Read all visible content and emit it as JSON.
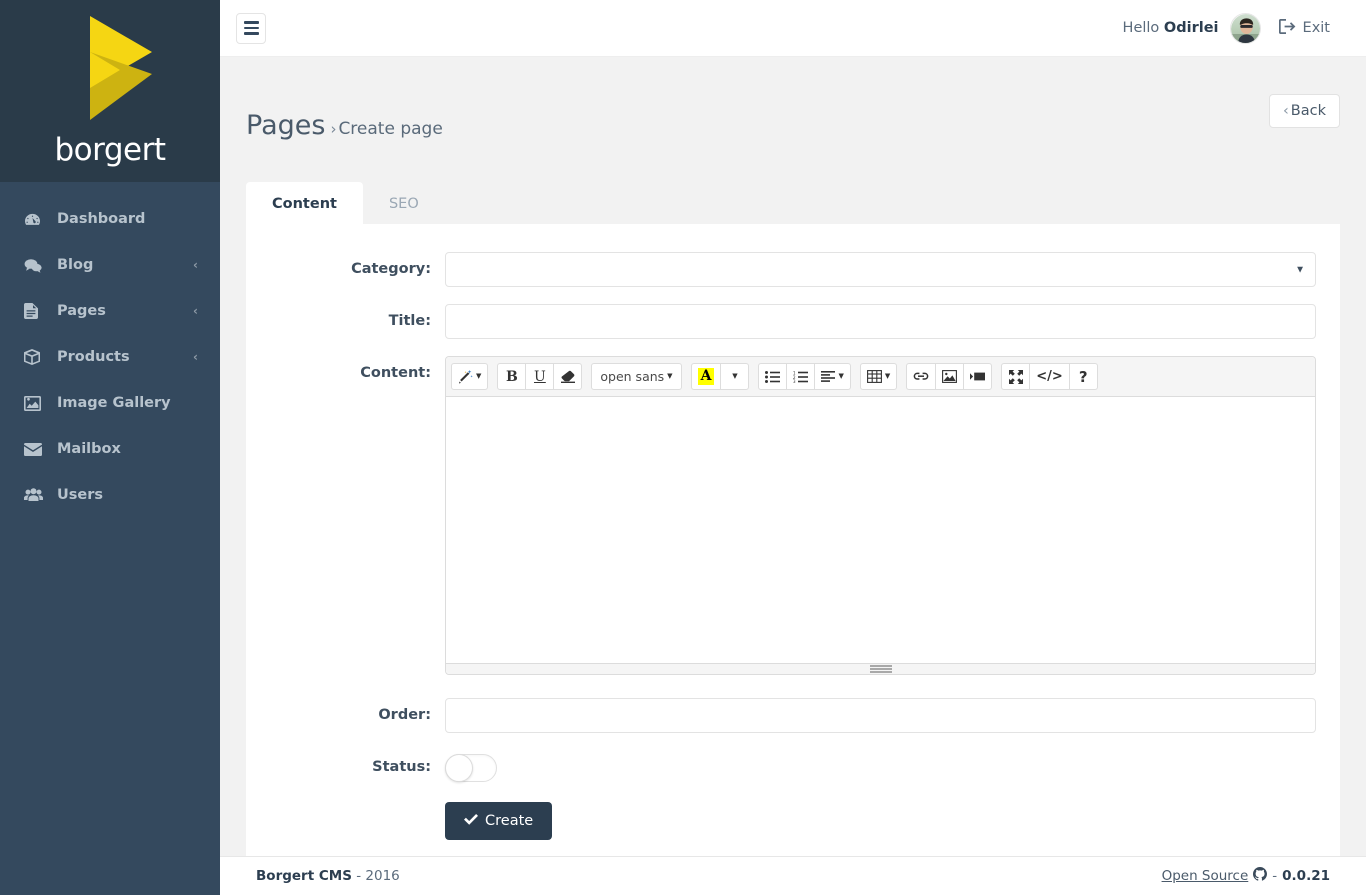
{
  "brand": {
    "logo_word": "borgert",
    "logo_icon": "play-triangle-logo",
    "colors": {
      "logo_light": "#f5d613",
      "logo_dark": "#cdb311",
      "sidebar": "#34495e",
      "sidebar_dark": "#2a3b49",
      "accent": "#2c3e50",
      "highlight": "#ffff00"
    }
  },
  "sidebar": {
    "items": [
      {
        "label": "Dashboard",
        "icon": "tachometer-icon",
        "caret": ""
      },
      {
        "label": "Blog",
        "icon": "comments-icon",
        "caret": "‹"
      },
      {
        "label": "Pages",
        "icon": "file-text-icon",
        "caret": "‹"
      },
      {
        "label": "Products",
        "icon": "cube-icon",
        "caret": "‹"
      },
      {
        "label": "Image Gallery",
        "icon": "image-icon",
        "caret": ""
      },
      {
        "label": "Mailbox",
        "icon": "envelope-icon",
        "caret": ""
      },
      {
        "label": "Users",
        "icon": "users-icon",
        "caret": ""
      }
    ]
  },
  "topbar": {
    "menu_icon": "hamburger-icon",
    "greeting": "Hello",
    "username": "Odirlei",
    "avatar_icon": "user-avatar-photo",
    "exit_icon": "sign-out-icon",
    "exit_label": "Exit"
  },
  "page": {
    "title": "Pages",
    "separator": "›",
    "breadcrumb": "Create page",
    "back_label": "Back",
    "back_chevron": "‹"
  },
  "tabs": [
    {
      "label": "Content",
      "active": true
    },
    {
      "label": "SEO",
      "active": false
    }
  ],
  "form": {
    "category": {
      "label": "Category:",
      "value": "",
      "placeholder": "",
      "options": [
        ""
      ]
    },
    "title": {
      "label": "Title:",
      "value": "",
      "placeholder": ""
    },
    "content": {
      "label": "Content:",
      "value": "",
      "placeholder": ""
    },
    "order": {
      "label": "Order:",
      "value": "",
      "placeholder": ""
    },
    "status": {
      "label": "Status:",
      "value": "off"
    },
    "submit": {
      "label": "Create",
      "icon": "check-icon"
    }
  },
  "editor": {
    "font_name": "open sans",
    "recent_color_letter": "A",
    "toolbar": [
      {
        "name": "style-magic-wand",
        "icon": "magic-icon",
        "caret": true
      },
      {
        "name": "bold",
        "icon": "bold-icon",
        "caret": false
      },
      {
        "name": "underline",
        "icon": "underline-icon",
        "caret": false
      },
      {
        "name": "clear-formatting",
        "icon": "eraser-icon",
        "caret": false
      },
      {
        "name": "font-name",
        "icon": "font-name-dropdown",
        "caret": true
      },
      {
        "name": "recent-color",
        "icon": "highlight-a-icon",
        "caret": false
      },
      {
        "name": "color-dropdown",
        "icon": "caret-down-icon",
        "caret": true
      },
      {
        "name": "unordered-list",
        "icon": "list-ul-icon",
        "caret": false
      },
      {
        "name": "ordered-list",
        "icon": "list-ol-icon",
        "caret": false
      },
      {
        "name": "paragraph-align",
        "icon": "align-left-icon",
        "caret": true
      },
      {
        "name": "table",
        "icon": "table-icon",
        "caret": true
      },
      {
        "name": "link",
        "icon": "link-icon",
        "caret": false
      },
      {
        "name": "picture",
        "icon": "picture-icon",
        "caret": false
      },
      {
        "name": "video",
        "icon": "video-icon",
        "caret": false
      },
      {
        "name": "fullscreen",
        "icon": "arrows-alt-icon",
        "caret": false
      },
      {
        "name": "code-view",
        "icon": "code-icon",
        "caret": false
      },
      {
        "name": "help",
        "icon": "question-icon",
        "caret": false
      }
    ],
    "code_label": "</>",
    "help_label": "?"
  },
  "footer": {
    "brand": "Borgert CMS",
    "year_sep": " - ",
    "year": "2016",
    "open_source_label": "Open Source",
    "github_icon": "github-icon",
    "version_sep": " - ",
    "version": "0.0.21"
  }
}
